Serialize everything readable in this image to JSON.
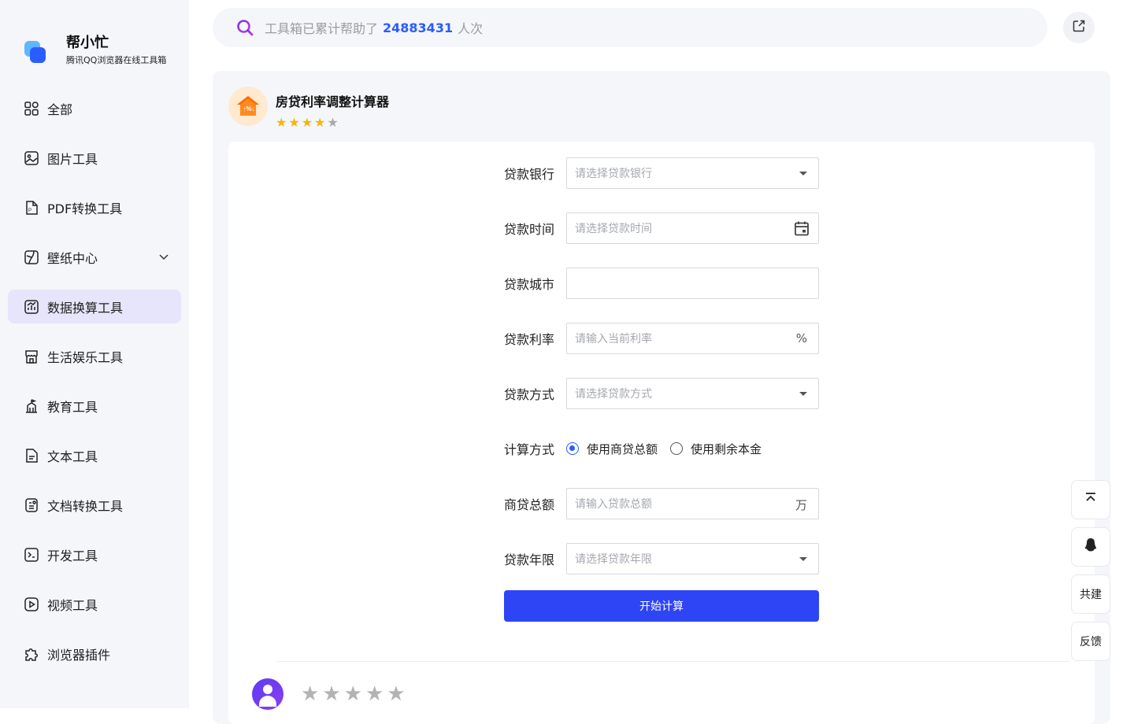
{
  "brand": {
    "name": "帮小忙",
    "subtitle": "腾讯QQ浏览器在线工具箱"
  },
  "sidebar": {
    "items": [
      {
        "label": "全部",
        "icon": "grid-icon"
      },
      {
        "label": "图片工具",
        "icon": "image-icon"
      },
      {
        "label": "PDF转换工具",
        "icon": "pdf-icon"
      },
      {
        "label": "壁纸中心",
        "icon": "wallpaper-icon"
      },
      {
        "label": "数据换算工具",
        "icon": "chart-icon",
        "active": true
      },
      {
        "label": "生活娱乐工具",
        "icon": "store-icon"
      },
      {
        "label": "教育工具",
        "icon": "school-icon"
      },
      {
        "label": "文本工具",
        "icon": "text-icon"
      },
      {
        "label": "文档转换工具",
        "icon": "document-icon"
      },
      {
        "label": "开发工具",
        "icon": "terminal-icon"
      },
      {
        "label": "视频工具",
        "icon": "video-icon"
      },
      {
        "label": "浏览器插件",
        "icon": "puzzle-icon"
      }
    ]
  },
  "search": {
    "prefix": "工具箱已累计帮助了",
    "count": "24883431",
    "suffix": "人次"
  },
  "tool": {
    "title": "房贷利率调整计算器",
    "rating": 4
  },
  "form": {
    "bank": {
      "label": "贷款银行",
      "placeholder": "请选择贷款银行"
    },
    "time": {
      "label": "贷款时间",
      "placeholder": "请选择贷款时间"
    },
    "city": {
      "label": "贷款城市",
      "value": ""
    },
    "rate": {
      "label": "贷款利率",
      "placeholder": "请输入当前利率",
      "suffix": "%"
    },
    "method": {
      "label": "贷款方式",
      "placeholder": "请选择贷款方式"
    },
    "calc": {
      "label": "计算方式",
      "option1": "使用商贷总额",
      "option2": "使用剩余本金",
      "selected": "option1"
    },
    "total": {
      "label": "商贷总额",
      "placeholder": "请输入贷款总额",
      "suffix": "万"
    },
    "years": {
      "label": "贷款年限",
      "placeholder": "请选择贷款年限"
    },
    "submit": "开始计算"
  },
  "floats": {
    "cobuild": "共建",
    "feedback": "反馈"
  },
  "colors": {
    "accent": "#2e45f5",
    "link": "#2a5bff",
    "star": "#f5b50d"
  }
}
